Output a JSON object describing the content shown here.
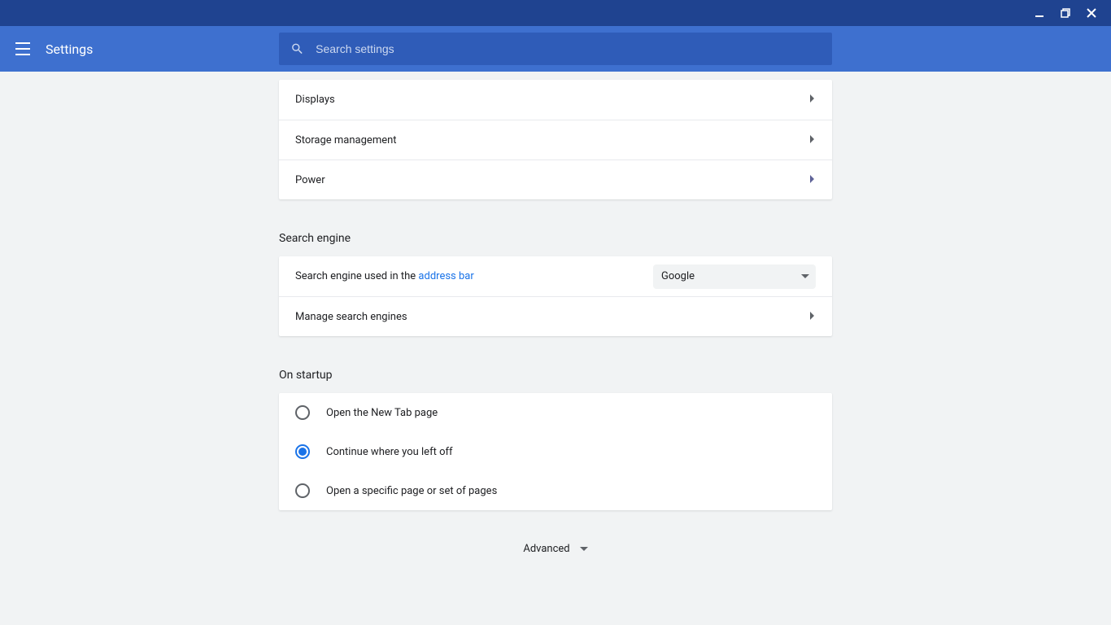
{
  "header": {
    "title": "Settings",
    "search_placeholder": "Search settings"
  },
  "device_section": {
    "items": [
      {
        "label": "Displays"
      },
      {
        "label": "Storage management"
      },
      {
        "label": "Power"
      }
    ]
  },
  "search_engine": {
    "title": "Search engine",
    "row_prefix": "Search engine used in the ",
    "row_link": "address bar",
    "selected": "Google",
    "manage_label": "Manage search engines"
  },
  "on_startup": {
    "title": "On startup",
    "options": [
      {
        "label": "Open the New Tab page",
        "selected": false
      },
      {
        "label": "Continue where you left off",
        "selected": true
      },
      {
        "label": "Open a specific page or set of pages",
        "selected": false
      }
    ]
  },
  "advanced_label": "Advanced"
}
